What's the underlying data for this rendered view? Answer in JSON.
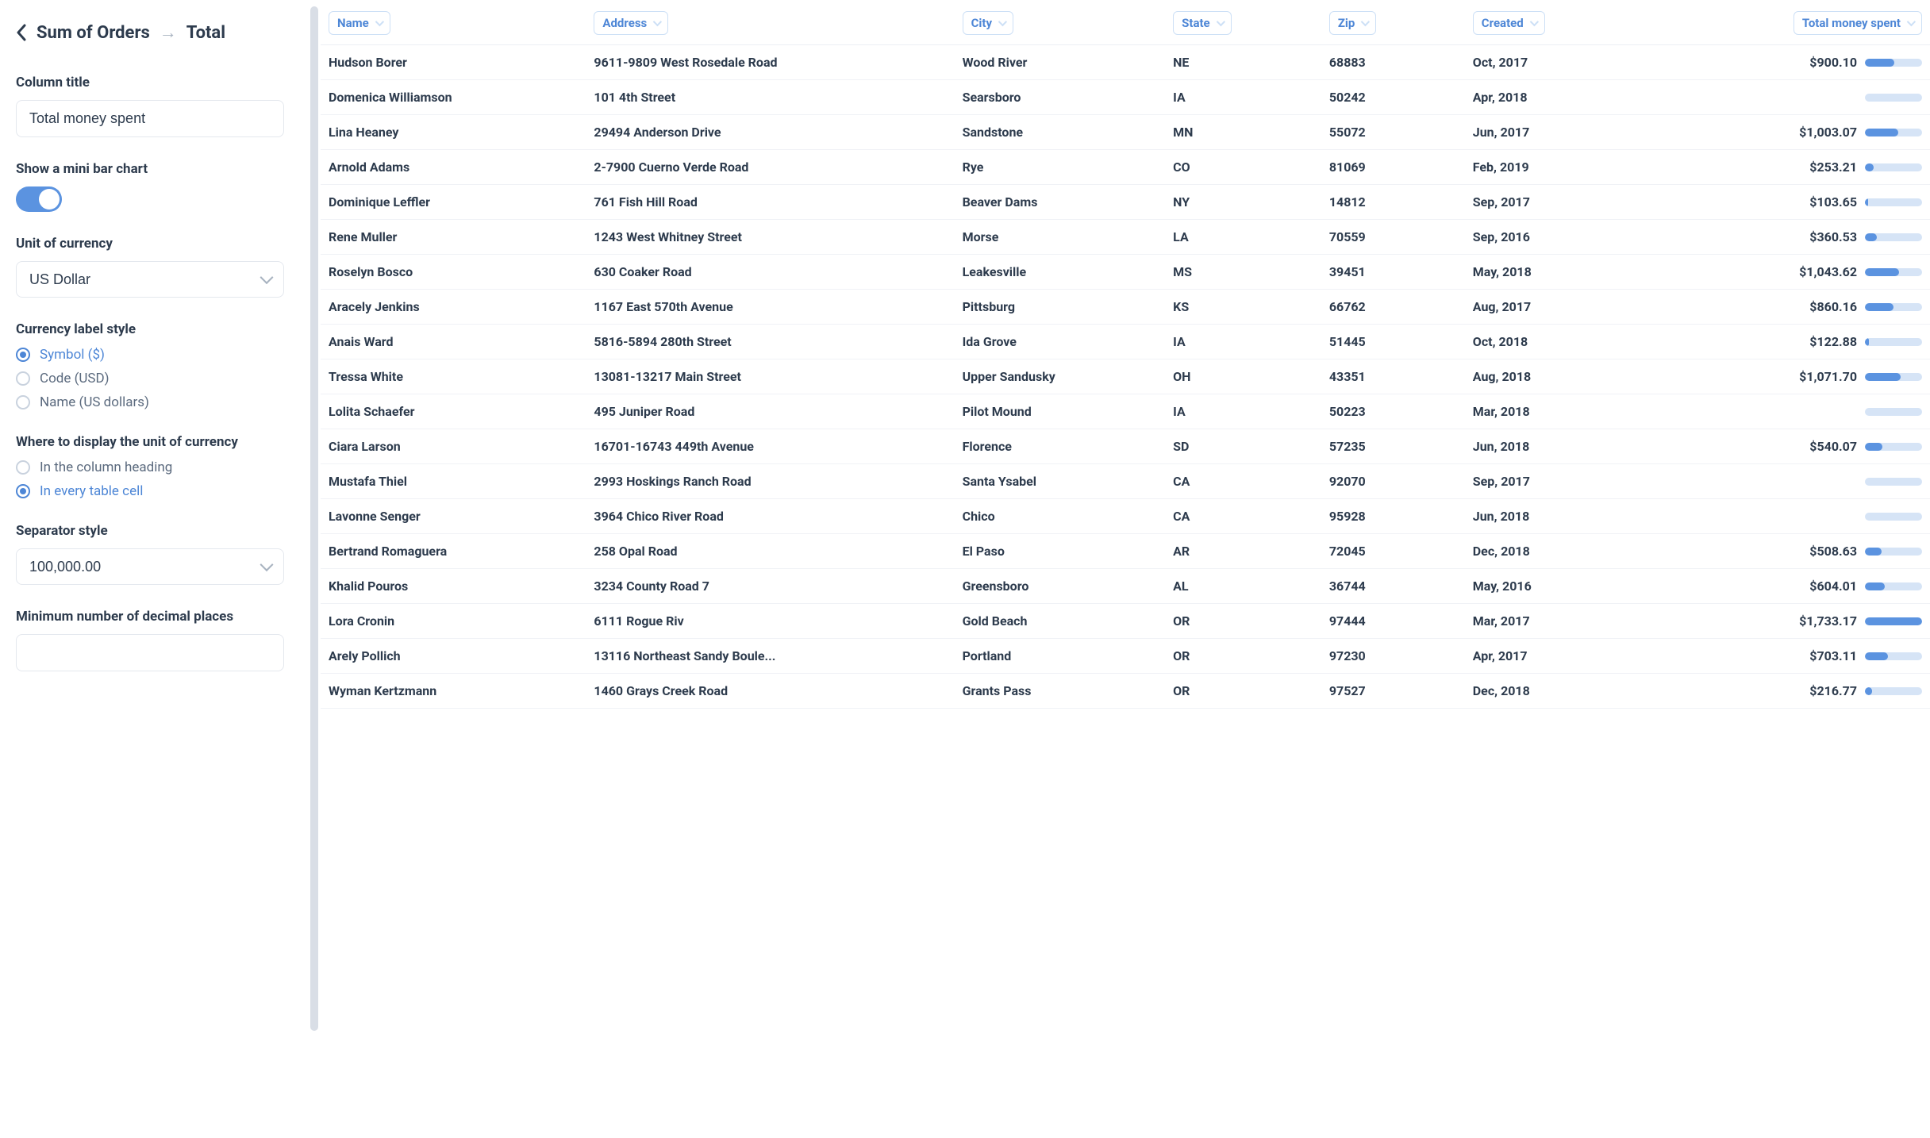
{
  "sidebar": {
    "breadcrumb_from": "Sum of Orders",
    "breadcrumb_to": "Total",
    "column_title_label": "Column title",
    "column_title_value": "Total money spent",
    "mini_bar_label": "Show a mini bar chart",
    "mini_bar_on": true,
    "currency_unit_label": "Unit of currency",
    "currency_unit_value": "US Dollar",
    "label_style_label": "Currency label style",
    "label_style_options": [
      {
        "label": "Symbol ($)",
        "selected": true
      },
      {
        "label": "Code (USD)",
        "selected": false
      },
      {
        "label": "Name (US dollars)",
        "selected": false
      }
    ],
    "display_unit_label": "Where to display the unit of currency",
    "display_unit_options": [
      {
        "label": "In the column heading",
        "selected": false
      },
      {
        "label": "In every table cell",
        "selected": true
      }
    ],
    "separator_label": "Separator style",
    "separator_value": "100,000.00",
    "min_decimals_label": "Minimum number of decimal places",
    "min_decimals_value": ""
  },
  "table": {
    "headers": [
      "Name",
      "Address",
      "City",
      "State",
      "Zip",
      "Created",
      "Total money spent"
    ],
    "bar_max": 1733.17,
    "rows": [
      {
        "name": "Hudson Borer",
        "address": "9611-9809 West Rosedale Road",
        "city": "Wood River",
        "state": "NE",
        "zip": "68883",
        "created": "Oct, 2017",
        "total": 900.1,
        "total_display": "$900.10"
      },
      {
        "name": "Domenica Williamson",
        "address": "101 4th Street",
        "city": "Searsboro",
        "state": "IA",
        "zip": "50242",
        "created": "Apr, 2018",
        "total": null,
        "total_display": ""
      },
      {
        "name": "Lina Heaney",
        "address": "29494 Anderson Drive",
        "city": "Sandstone",
        "state": "MN",
        "zip": "55072",
        "created": "Jun, 2017",
        "total": 1003.07,
        "total_display": "$1,003.07"
      },
      {
        "name": "Arnold Adams",
        "address": "2-7900 Cuerno Verde Road",
        "city": "Rye",
        "state": "CO",
        "zip": "81069",
        "created": "Feb, 2019",
        "total": 253.21,
        "total_display": "$253.21"
      },
      {
        "name": "Dominique Leffler",
        "address": "761 Fish Hill Road",
        "city": "Beaver Dams",
        "state": "NY",
        "zip": "14812",
        "created": "Sep, 2017",
        "total": 103.65,
        "total_display": "$103.65"
      },
      {
        "name": "Rene Muller",
        "address": "1243 West Whitney Street",
        "city": "Morse",
        "state": "LA",
        "zip": "70559",
        "created": "Sep, 2016",
        "total": 360.53,
        "total_display": "$360.53"
      },
      {
        "name": "Roselyn Bosco",
        "address": "630 Coaker Road",
        "city": "Leakesville",
        "state": "MS",
        "zip": "39451",
        "created": "May, 2018",
        "total": 1043.62,
        "total_display": "$1,043.62"
      },
      {
        "name": "Aracely Jenkins",
        "address": "1167 East 570th Avenue",
        "city": "Pittsburg",
        "state": "KS",
        "zip": "66762",
        "created": "Aug, 2017",
        "total": 860.16,
        "total_display": "$860.16"
      },
      {
        "name": "Anais Ward",
        "address": "5816-5894 280th Street",
        "city": "Ida Grove",
        "state": "IA",
        "zip": "51445",
        "created": "Oct, 2018",
        "total": 122.88,
        "total_display": "$122.88"
      },
      {
        "name": "Tressa White",
        "address": "13081-13217 Main Street",
        "city": "Upper Sandusky",
        "state": "OH",
        "zip": "43351",
        "created": "Aug, 2018",
        "total": 1071.7,
        "total_display": "$1,071.70"
      },
      {
        "name": "Lolita Schaefer",
        "address": "495 Juniper Road",
        "city": "Pilot Mound",
        "state": "IA",
        "zip": "50223",
        "created": "Mar, 2018",
        "total": null,
        "total_display": ""
      },
      {
        "name": "Ciara Larson",
        "address": "16701-16743 449th Avenue",
        "city": "Florence",
        "state": "SD",
        "zip": "57235",
        "created": "Jun, 2018",
        "total": 540.07,
        "total_display": "$540.07"
      },
      {
        "name": "Mustafa Thiel",
        "address": "2993 Hoskings Ranch Road",
        "city": "Santa Ysabel",
        "state": "CA",
        "zip": "92070",
        "created": "Sep, 2017",
        "total": null,
        "total_display": ""
      },
      {
        "name": "Lavonne Senger",
        "address": "3964 Chico River Road",
        "city": "Chico",
        "state": "CA",
        "zip": "95928",
        "created": "Jun, 2018",
        "total": null,
        "total_display": ""
      },
      {
        "name": "Bertrand Romaguera",
        "address": "258 Opal Road",
        "city": "El Paso",
        "state": "AR",
        "zip": "72045",
        "created": "Dec, 2018",
        "total": 508.63,
        "total_display": "$508.63"
      },
      {
        "name": "Khalid Pouros",
        "address": "3234 County Road 7",
        "city": "Greensboro",
        "state": "AL",
        "zip": "36744",
        "created": "May, 2016",
        "total": 604.01,
        "total_display": "$604.01"
      },
      {
        "name": "Lora Cronin",
        "address": "6111 Rogue Riv",
        "city": "Gold Beach",
        "state": "OR",
        "zip": "97444",
        "created": "Mar, 2017",
        "total": 1733.17,
        "total_display": "$1,733.17"
      },
      {
        "name": "Arely Pollich",
        "address": "13116 Northeast Sandy Boule...",
        "city": "Portland",
        "state": "OR",
        "zip": "97230",
        "created": "Apr, 2017",
        "total": 703.11,
        "total_display": "$703.11"
      },
      {
        "name": "Wyman Kertzmann",
        "address": "1460 Grays Creek Road",
        "city": "Grants Pass",
        "state": "OR",
        "zip": "97527",
        "created": "Dec, 2018",
        "total": 216.77,
        "total_display": "$216.77"
      }
    ]
  }
}
